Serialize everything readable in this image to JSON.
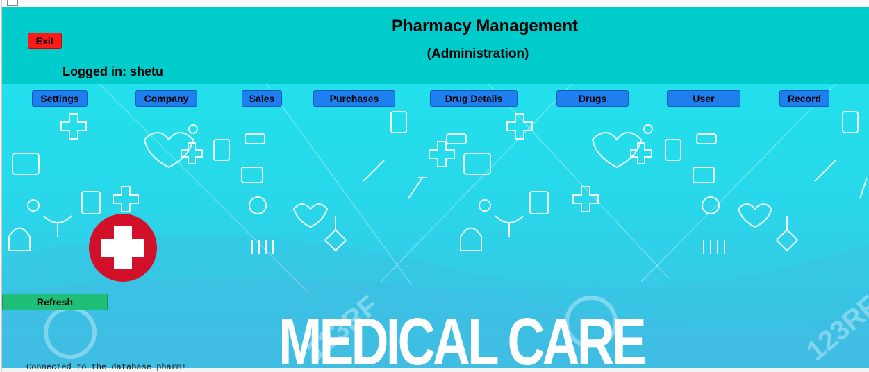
{
  "header": {
    "title": "Pharmacy Management",
    "subtitle": "(Administration)",
    "logged_in": "Logged in: shetu",
    "exit_label": "Exit"
  },
  "nav": {
    "items": [
      {
        "label": "Settings"
      },
      {
        "label": "Company"
      },
      {
        "label": "Sales"
      },
      {
        "label": "Purchases"
      },
      {
        "label": "Drug Details"
      },
      {
        "label": "Drugs"
      },
      {
        "label": "User"
      },
      {
        "label": "Record"
      }
    ]
  },
  "banner": {
    "headline": "MEDICAL CARE",
    "watermark": "123RF"
  },
  "actions": {
    "refresh_label": "Refresh"
  },
  "console": {
    "text": "Connected to the database pharm!"
  },
  "colors": {
    "header_bg": "#00cccc",
    "nav_button": "#1e7ff0",
    "exit_button": "#ff1a1a",
    "refresh_button": "#1fbf78",
    "badge": "#d2102a"
  },
  "icons": [
    "medical-cross-badge-icon",
    "medical-doodle-pattern"
  ]
}
